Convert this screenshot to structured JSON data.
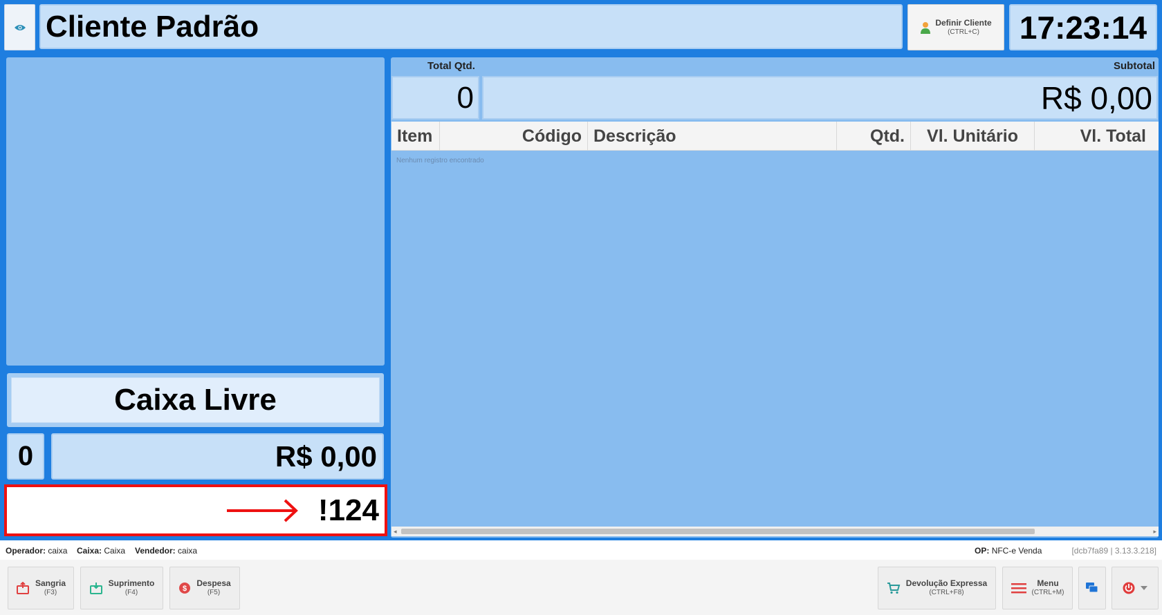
{
  "header": {
    "client_name": "Cliente Padrão",
    "define_client_label": "Definir Cliente",
    "define_client_shortcut": "(CTRL+C)",
    "clock": "17:23:14"
  },
  "left": {
    "status": "Caixa Livre",
    "item_count": "0",
    "total": "R$ 0,00",
    "input_value": "!124"
  },
  "right": {
    "total_qtd_label": "Total Qtd.",
    "total_qtd_value": "0",
    "subtotal_label": "Subtotal",
    "subtotal_value": "R$ 0,00",
    "columns": [
      "Item",
      "Código",
      "Descrição",
      "Qtd.",
      "Vl. Unitário",
      "Vl. Total"
    ],
    "empty_message": "Nenhum registro encontrado"
  },
  "status_bar": {
    "operador_label": "Operador:",
    "operador_value": "caixa",
    "caixa_label": "Caixa:",
    "caixa_value": "Caixa",
    "vendedor_label": "Vendedor:",
    "vendedor_value": "caixa",
    "op_label": "OP:",
    "op_value": "NFC-e Venda",
    "version": "[dcb7fa89 | 3.13.3.218]"
  },
  "footer": {
    "sangria_label": "Sangria",
    "sangria_shortcut": "(F3)",
    "suprimento_label": "Suprimento",
    "suprimento_shortcut": "(F4)",
    "despesa_label": "Despesa",
    "despesa_shortcut": "(F5)",
    "devolucao_label": "Devolução Expressa",
    "devolucao_shortcut": "(CTRL+F8)",
    "menu_label": "Menu",
    "menu_shortcut": "(CTRL+M)"
  },
  "icons": {
    "eye": "eye-icon",
    "user": "user-icon",
    "arrow": "arrow-right-icon",
    "sangria": "money-bag-out-icon",
    "suprimento": "money-tray-in-icon",
    "despesa": "coin-icon",
    "devolucao": "cart-icon",
    "menu": "hamburger-menu-icon",
    "chat": "chat-icon",
    "power": "power-icon",
    "dropdown": "caret-down-icon"
  },
  "colors": {
    "background_blue": "#1e7ee0",
    "panel_blue": "#88bcef",
    "field_blue": "#c7e0f8",
    "input_border_red": "#ee1111"
  }
}
